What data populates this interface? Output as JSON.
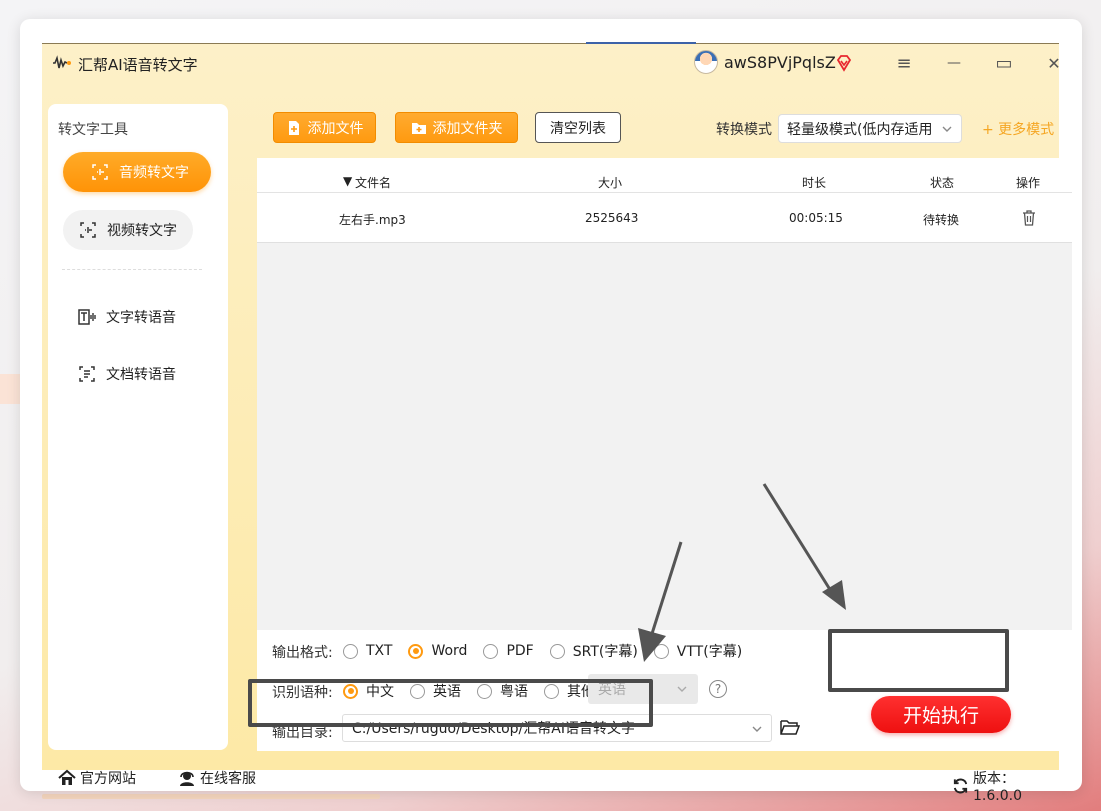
{
  "app": {
    "title": "汇帮AI语音转文字",
    "username": "awS8PVjPqlsZ"
  },
  "window_controls": {
    "menu": "≡",
    "minimize": "—",
    "maximize": "▭",
    "close": "✕"
  },
  "sidebar": {
    "header": "转文字工具",
    "primary_items": [
      {
        "label": "音频转文字",
        "icon": "audio-scan-icon",
        "active": true
      },
      {
        "label": "视频转文字",
        "icon": "video-scan-icon",
        "active": false
      }
    ],
    "secondary_items": [
      {
        "label": "文字转语音",
        "icon": "text-to-speech-icon"
      },
      {
        "label": "文档转语音",
        "icon": "doc-to-speech-icon"
      }
    ]
  },
  "toolbar": {
    "add_file": "添加文件",
    "add_folder": "添加文件夹",
    "clear_list": "清空列表",
    "mode_label": "转换模式",
    "mode_value": "轻量级模式(低内存适用",
    "more_modes": "+ 更多模式"
  },
  "table": {
    "columns": [
      "文件名",
      "大小",
      "时长",
      "状态",
      "操作"
    ],
    "rows": [
      {
        "name": "左右手.mp3",
        "size": "2525643",
        "duration": "00:05:15",
        "status": "待转换"
      }
    ]
  },
  "options": {
    "format_label": "输出格式:",
    "formats": [
      "TXT",
      "Word",
      "PDF",
      "SRT(字幕)",
      "VTT(字幕)"
    ],
    "format_selected": "Word",
    "lang_label": "识别语种:",
    "languages": [
      "中文",
      "英语",
      "粤语",
      "其他"
    ],
    "lang_selected": "中文",
    "other_lang_value": "英语",
    "dir_label": "输出目录:",
    "dir_value": "C:/Users/ruguo/Desktop/汇帮AI语音转文字",
    "help": "?"
  },
  "start_button": "开始执行",
  "footer": {
    "website": "官方网站",
    "support": "在线客服",
    "version": "版本：1.6.0.0"
  },
  "colors": {
    "accent_orange": "#ff9a10",
    "start_red": "#f21a1a",
    "panel_yellow": "#fde9a6"
  }
}
